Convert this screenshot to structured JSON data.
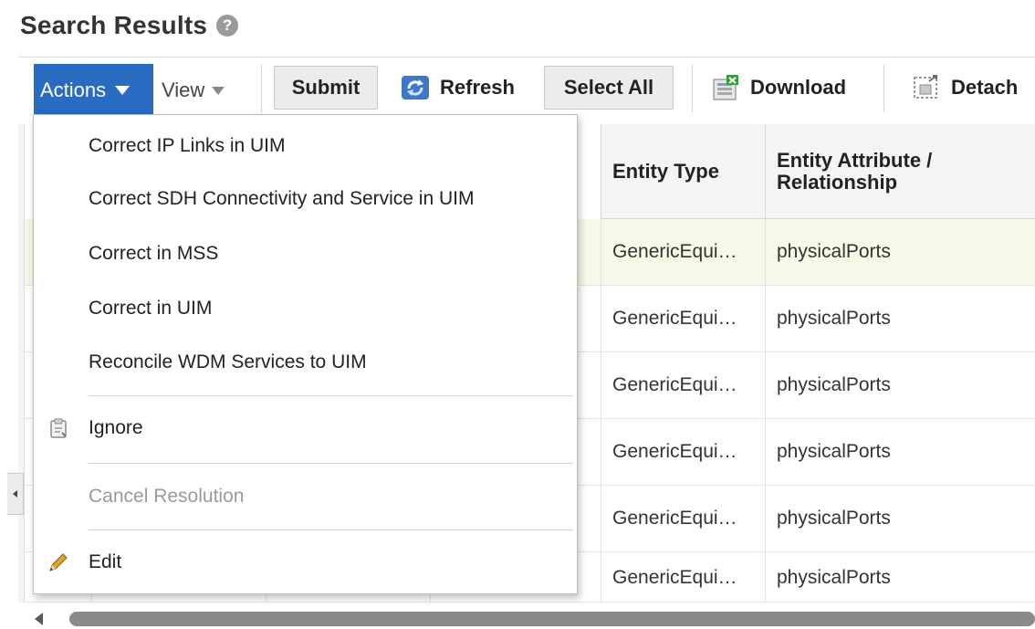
{
  "page": {
    "title": "Search Results",
    "help_glyph": "?"
  },
  "toolbar": {
    "actions_label": "Actions",
    "view_label": "View",
    "submit_label": "Submit",
    "refresh_label": "Refresh",
    "select_all_label": "Select All",
    "download_label": "Download",
    "detach_label": "Detach"
  },
  "table": {
    "columns": [
      "Entity Type",
      "Entity Attribute / Relationship"
    ],
    "rows": [
      {
        "entity_type": "GenericEqui…",
        "attribute": "physicalPorts",
        "selected": true
      },
      {
        "entity_type": "GenericEqui…",
        "attribute": "physicalPorts"
      },
      {
        "entity_type": "GenericEqui…",
        "attribute": "physicalPorts"
      },
      {
        "entity_type": "GenericEqui…",
        "attribute": "physicalPorts"
      },
      {
        "entity_type": "GenericEqui…",
        "attribute": "physicalPorts"
      },
      {
        "entity_type": "GenericEqui…",
        "attribute": "physicalPorts"
      }
    ]
  },
  "actions_menu": {
    "items": [
      {
        "label": "Correct IP Links in UIM"
      },
      {
        "label": "Correct SDH Connectivity and Service in UIM"
      },
      {
        "label": "Correct in MSS"
      },
      {
        "label": "Correct in UIM"
      },
      {
        "label": "Reconcile WDM Services to UIM"
      },
      {
        "label": "Ignore",
        "icon": "clipboard-icon"
      },
      {
        "label": "Cancel Resolution",
        "disabled": true
      },
      {
        "label": "Edit",
        "icon": "pencil-icon"
      }
    ]
  },
  "colors": {
    "accent": "#2a6bc2",
    "selected_row": "#f8f8e8",
    "toolbar_button": "#ececec"
  }
}
